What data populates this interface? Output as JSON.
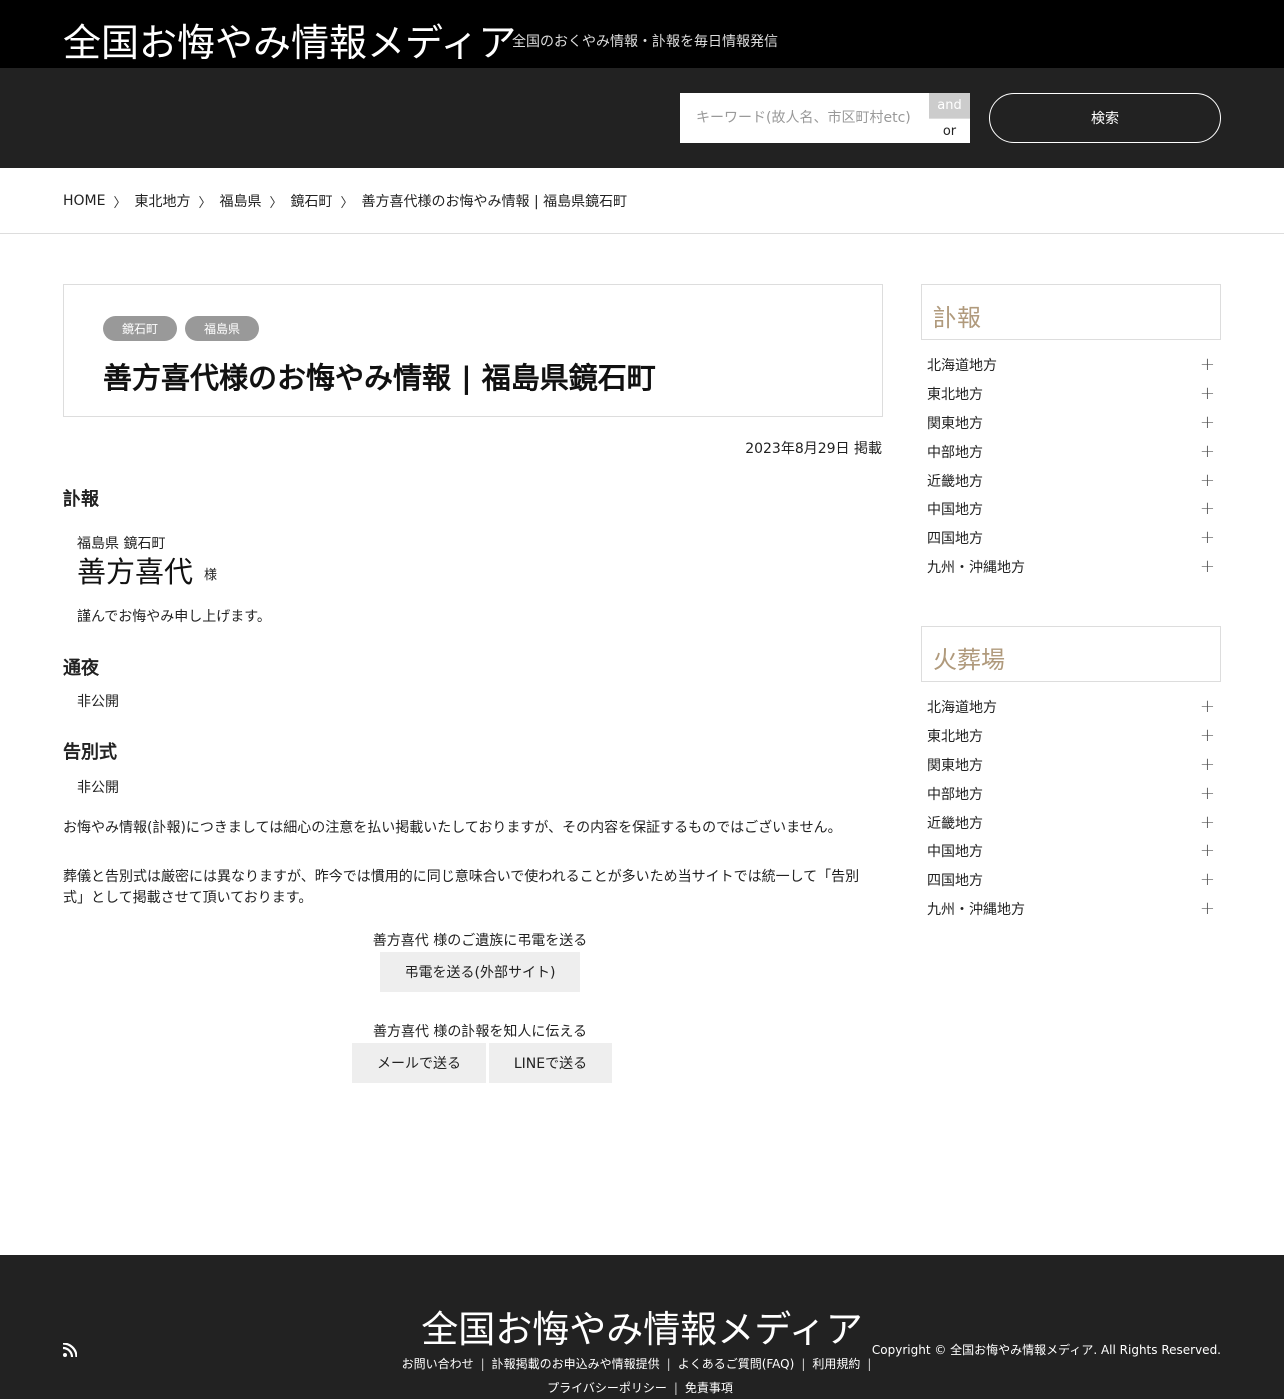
{
  "header": {
    "site_title": "全国お悔やみ情報メディア",
    "tagline": "全国のおくやみ情報・訃報を毎日情報発信"
  },
  "search": {
    "placeholder": "キーワード(故人名、市区町村etc)",
    "mode_and": "and",
    "mode_or": "or",
    "button_label": "検索"
  },
  "breadcrumb": {
    "items": [
      "HOME",
      "東北地方",
      "福島県",
      "鏡石町",
      "善方喜代様のお悔やみ情報 | 福島県鏡石町"
    ],
    "separator": "〉"
  },
  "post": {
    "tags": [
      "鏡石町",
      "福島県"
    ],
    "title": "善方喜代様のお悔やみ情報 | 福島県鏡石町",
    "date": "2023年8月29日 掲載",
    "sections": {
      "fuho": "訃報",
      "tsuya": "通夜",
      "kokubetsu": "告別式"
    },
    "deceased": {
      "location": "福島県 鏡石町",
      "name": "善方喜代",
      "honorific": "様"
    },
    "condolence": "謹んでお悔やみ申し上げます。",
    "tsuya_value": "非公開",
    "kokubetsu_value": "非公開",
    "notice_1": "お悔やみ情報(訃報)につきましては細心の注意を払い掲載いたしておりますが、その内容を保証するものではございません。",
    "notice_2": "葬儀と告別式は厳密には異なりますが、昨今では慣用的に同じ意味合いで使われることが多いため当サイトでは統一して「告別式」として掲載させて頂いております。",
    "choden_label": "善方喜代 様のご遺族に弔電を送る",
    "choden_button": "弔電を送る(外部サイト)",
    "share_label": "善方喜代 様の訃報を知人に伝える",
    "mail_button": "メールで送る",
    "line_button": "LINEで送る"
  },
  "sidebar": {
    "fuho_title": "訃報",
    "kasoba_title": "火葬場",
    "regions": [
      "北海道地方",
      "東北地方",
      "関東地方",
      "中部地方",
      "近畿地方",
      "中国地方",
      "四国地方",
      "九州・沖縄地方"
    ],
    "expand_icon": "plus-icon"
  },
  "footer": {
    "site_title": "全国お悔やみ情報メディア",
    "links_row1": [
      "お問い合わせ",
      "訃報掲載のお申込みや情報提供",
      "よくあるご質問(FAQ)",
      "利用規約"
    ],
    "links_row2": [
      "プライバシーポリシー",
      "免責事項"
    ],
    "copyright": "Copyright © 全国お悔やみ情報メディア. All Rights Reserved.",
    "rss_icon": "rss-icon"
  },
  "colors": {
    "header_bg": "#000000",
    "search_bg": "#222222",
    "sidebar_title": "#b09a7c",
    "tag_bg": "#999999",
    "footer_bg": "#222222"
  }
}
